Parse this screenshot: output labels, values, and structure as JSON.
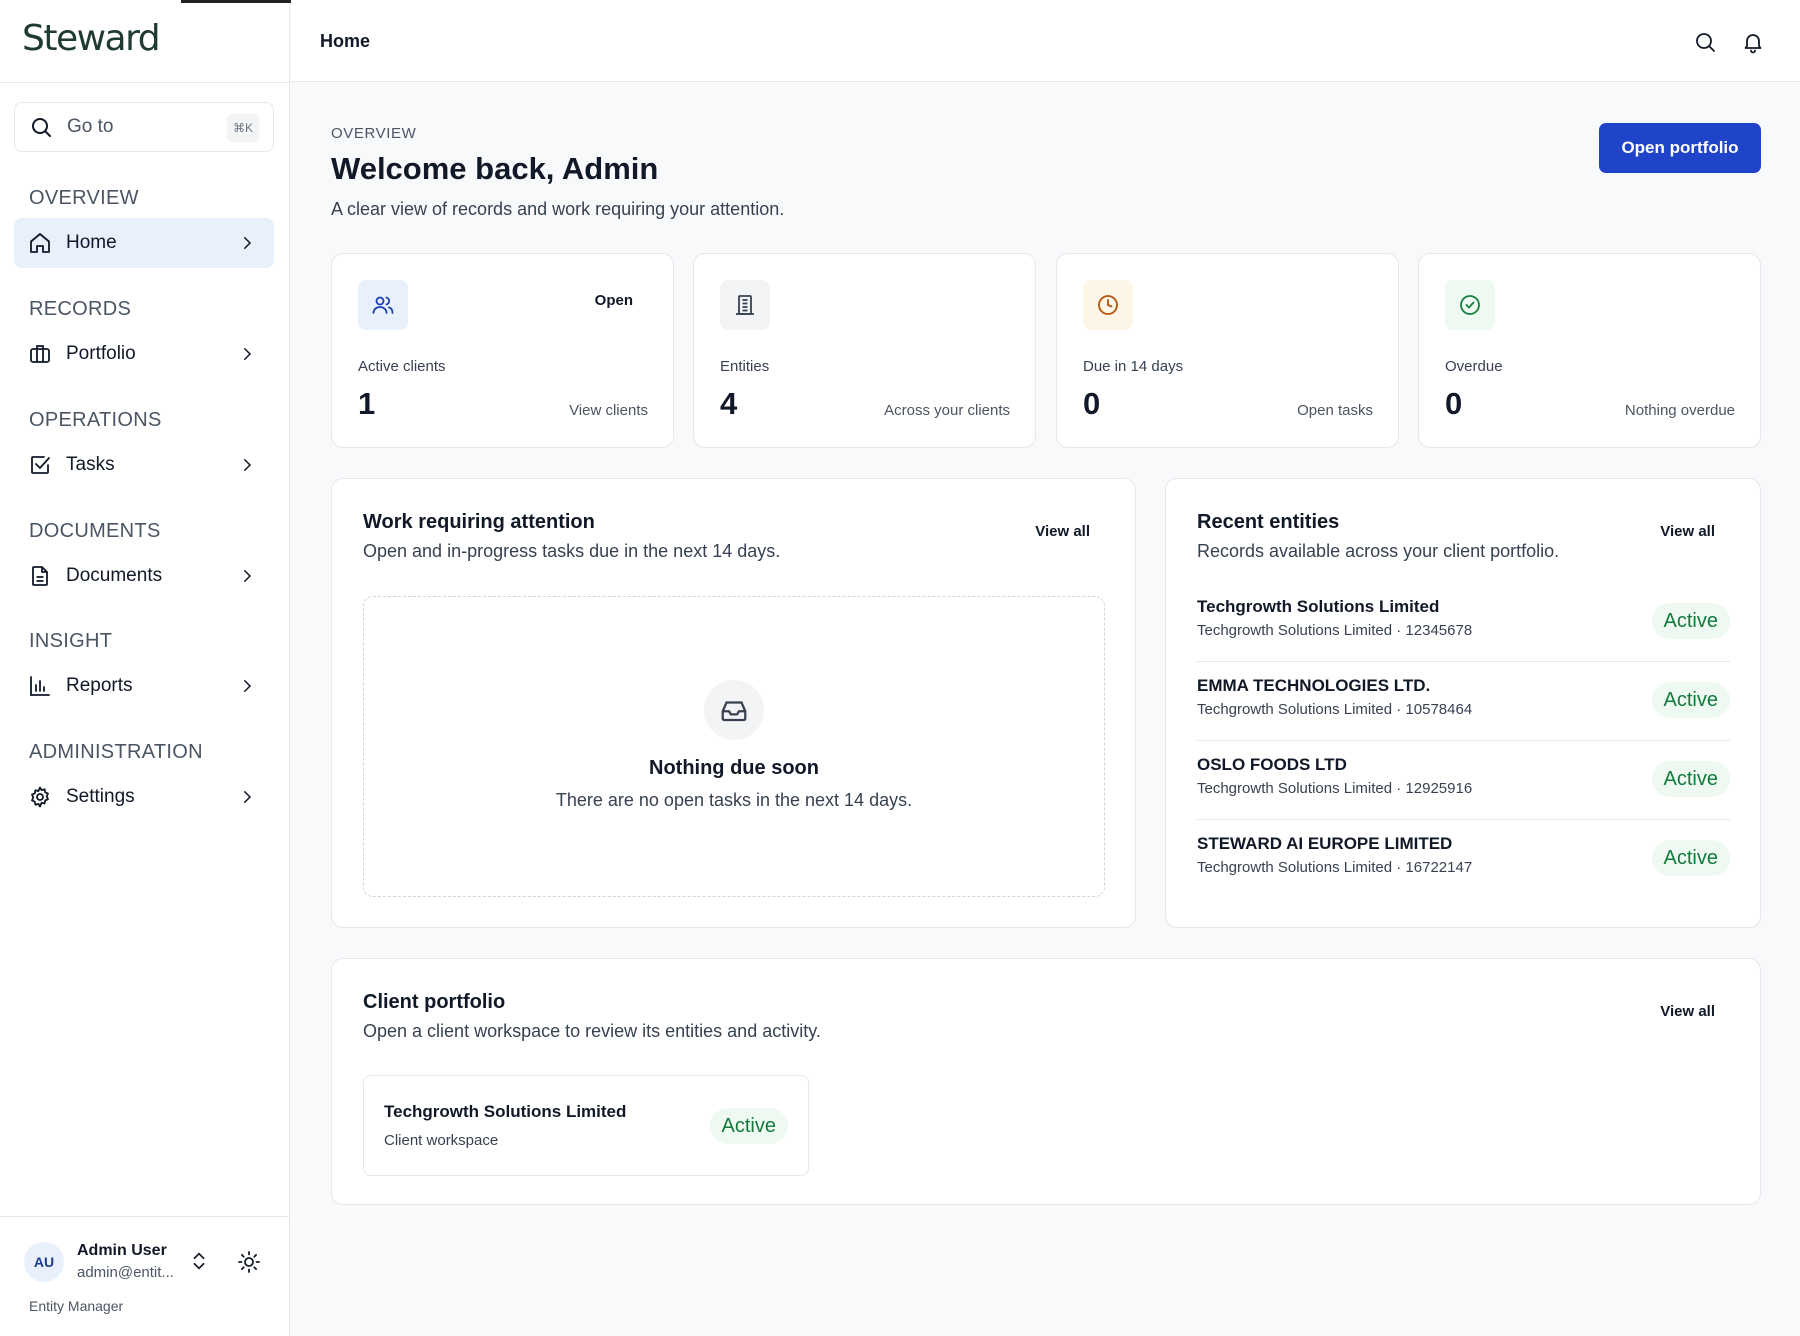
{
  "app": {
    "logo": "Steward"
  },
  "sidebar": {
    "search": {
      "label": "Go to",
      "shortcut": "⌘K"
    },
    "sections": [
      {
        "title": "OVERVIEW",
        "items": [
          {
            "label": "Home",
            "icon": "home-icon",
            "active": true
          }
        ]
      },
      {
        "title": "RECORDS",
        "items": [
          {
            "label": "Portfolio",
            "icon": "briefcase-icon"
          }
        ]
      },
      {
        "title": "OPERATIONS",
        "items": [
          {
            "label": "Tasks",
            "icon": "checkbox-icon"
          }
        ]
      },
      {
        "title": "DOCUMENTS",
        "items": [
          {
            "label": "Documents",
            "icon": "document-icon"
          }
        ]
      },
      {
        "title": "INSIGHT",
        "items": [
          {
            "label": "Reports",
            "icon": "bar-chart-icon"
          }
        ]
      },
      {
        "title": "ADMINISTRATION",
        "items": [
          {
            "label": "Settings",
            "icon": "gear-icon"
          }
        ]
      }
    ],
    "user": {
      "initials": "AU",
      "name": "Admin User",
      "email": "admin@entit...",
      "role": "Entity Manager"
    }
  },
  "header": {
    "breadcrumb": "Home"
  },
  "main": {
    "eyebrow": "OVERVIEW",
    "title": "Welcome back, Admin",
    "subtitle": "A clear view of records and work requiring your attention.",
    "primary_action": "Open portfolio",
    "stats": [
      {
        "icon": "users-icon",
        "tag": "Open",
        "label": "Active clients",
        "value": "1",
        "link": "View clients",
        "icon_bg": "#e8f0fc",
        "icon_color": "#1e40af"
      },
      {
        "icon": "building-icon",
        "tag": "",
        "label": "Entities",
        "value": "4",
        "link": "Across your clients",
        "icon_bg": "#f3f4f6",
        "icon_color": "#374151"
      },
      {
        "icon": "clock-icon",
        "tag": "",
        "label": "Due in 14 days",
        "value": "0",
        "link": "Open tasks",
        "icon_bg": "#fdf6e7",
        "icon_color": "#b45309"
      },
      {
        "icon": "check-circle-icon",
        "tag": "",
        "label": "Overdue",
        "value": "0",
        "link": "Nothing overdue",
        "icon_bg": "#eefaf1",
        "icon_color": "#15803d"
      }
    ],
    "work": {
      "title": "Work requiring attention",
      "subtitle": "Open and in-progress tasks due in the next 14 days.",
      "view_all": "View all",
      "empty_title": "Nothing due soon",
      "empty_subtitle": "There are no open tasks in the next 14 days."
    },
    "recent": {
      "title": "Recent entities",
      "subtitle": "Records available across your client portfolio.",
      "view_all": "View all",
      "items": [
        {
          "name": "Techgrowth Solutions Limited",
          "meta": "Techgrowth Solutions Limited · 12345678",
          "status": "Active"
        },
        {
          "name": "EMMA TECHNOLOGIES LTD.",
          "meta": "Techgrowth Solutions Limited · 10578464",
          "status": "Active"
        },
        {
          "name": "OSLO FOODS LTD",
          "meta": "Techgrowth Solutions Limited · 12925916",
          "status": "Active"
        },
        {
          "name": "STEWARD AI EUROPE LIMITED",
          "meta": "Techgrowth Solutions Limited · 16722147",
          "status": "Active"
        }
      ]
    },
    "portfolio": {
      "title": "Client portfolio",
      "subtitle": "Open a client workspace to review its entities and activity.",
      "view_all": "View all",
      "clients": [
        {
          "name": "Techgrowth Solutions Limited",
          "meta": "Client workspace",
          "status": "Active"
        }
      ]
    }
  }
}
